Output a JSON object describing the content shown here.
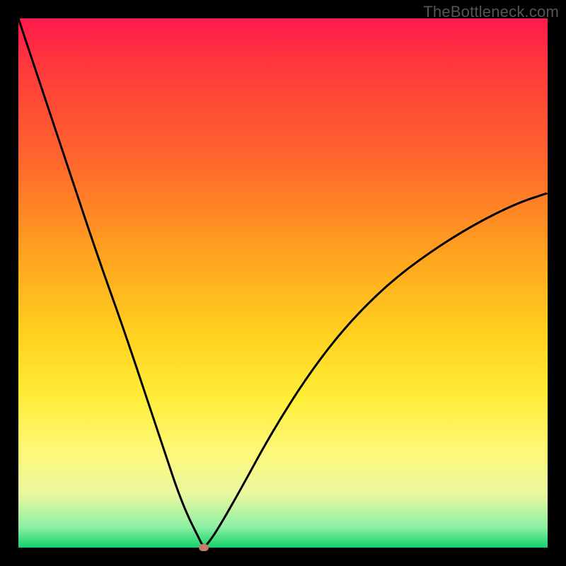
{
  "watermark": "TheBottleneck.com",
  "colors": {
    "frame": "#000000",
    "watermark_text": "#555555",
    "curve": "#000000",
    "marker": "#c97a6a",
    "gradient_top": "#ff1a4d",
    "gradient_bottom": "#15d36b"
  },
  "chart_data": {
    "type": "line",
    "title": "",
    "xlabel": "",
    "ylabel": "",
    "xlim": [
      0,
      100
    ],
    "ylim": [
      0,
      100
    ],
    "grid": false,
    "legend": false,
    "annotations": [
      "TheBottleneck.com"
    ],
    "series": [
      {
        "name": "bottleneck-curve",
        "x": [
          0,
          5,
          10,
          15,
          20,
          25,
          28,
          30,
          32,
          34,
          35,
          36,
          38,
          42,
          48,
          55,
          62,
          70,
          78,
          86,
          94,
          100
        ],
        "values": [
          100,
          85,
          70,
          55,
          41,
          26,
          17,
          11,
          6,
          2,
          0,
          1,
          4,
          11,
          22,
          33,
          42,
          50,
          56,
          61,
          65,
          67
        ]
      }
    ],
    "marker": {
      "x": 35,
      "y": 0
    }
  },
  "layout": {
    "image_size": 800,
    "plot_inset": 26,
    "plot_size": 748
  }
}
